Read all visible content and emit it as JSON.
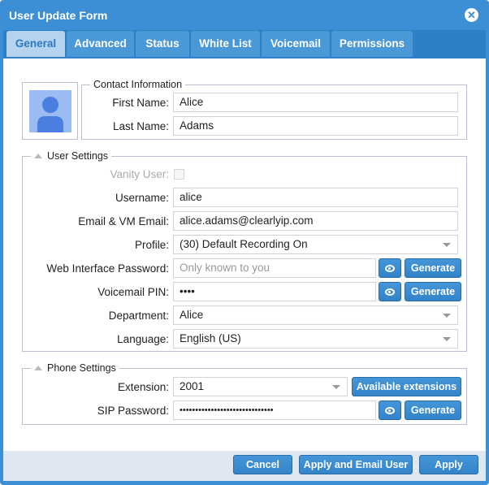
{
  "window": {
    "title": "User Update Form"
  },
  "tabs": [
    "General",
    "Advanced",
    "Status",
    "White List",
    "Voicemail",
    "Permissions"
  ],
  "contact": {
    "legend": "Contact Information",
    "first_name_label": "First Name:",
    "first_name": "Alice",
    "last_name_label": "Last Name:",
    "last_name": "Adams"
  },
  "user_settings": {
    "legend": "User Settings",
    "vanity_label": "Vanity User:",
    "username_label": "Username:",
    "username": "alice",
    "email_label": "Email & VM Email:",
    "email": "alice.adams@clearlyip.com",
    "profile_label": "Profile:",
    "profile": "(30) Default Recording On",
    "web_pw_label": "Web Interface Password:",
    "web_pw_placeholder": "Only known to you",
    "vm_pin_label": "Voicemail PIN:",
    "vm_pin": "••••",
    "department_label": "Department:",
    "department": "Alice",
    "language_label": "Language:",
    "language": "English (US)",
    "generate": "Generate"
  },
  "phone_settings": {
    "legend": "Phone Settings",
    "extension_label": "Extension:",
    "extension": "2001",
    "available_extensions": "Available extensions",
    "sip_label": "SIP Password:",
    "sip_password": "••••••••••••••••••••••••••••••",
    "generate": "Generate"
  },
  "footer": {
    "cancel": "Cancel",
    "apply_email": "Apply and Email User",
    "apply": "Apply"
  }
}
